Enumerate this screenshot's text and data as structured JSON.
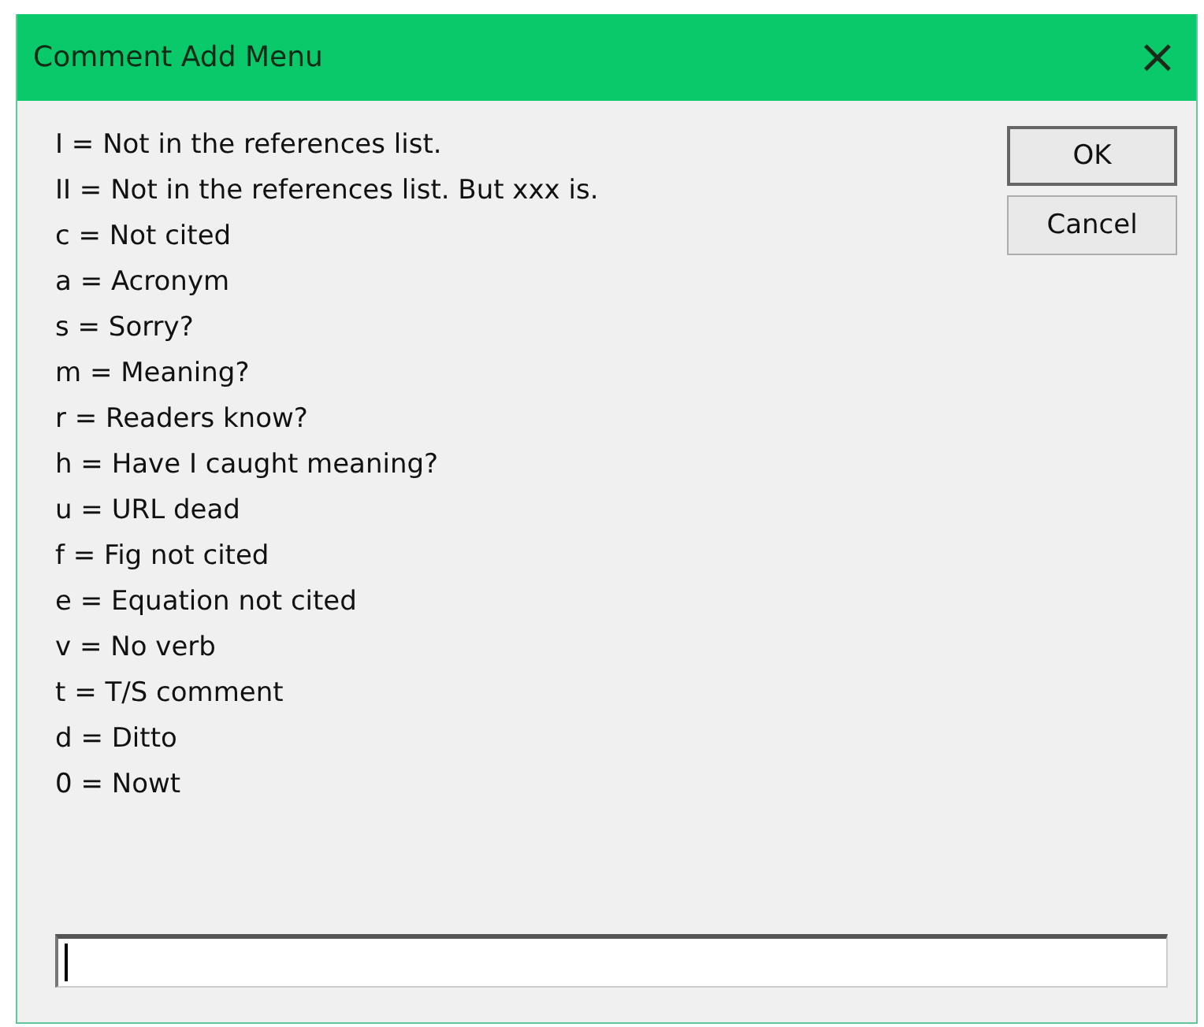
{
  "window": {
    "title": "Comment Add Menu",
    "close": "×"
  },
  "items": [
    "I = Not in the references list.",
    "II = Not in the references list. But xxx is.",
    "c = Not cited",
    "a = Acronym",
    "s = Sorry?",
    "m = Meaning?",
    "r = Readers know?",
    "h = Have I caught meaning?",
    "u = URL dead",
    "f = Fig not cited",
    "e = Equation not cited",
    "v = No verb",
    "t = T/S comment",
    "d = Ditto",
    "0 = Nowt"
  ],
  "buttons": [
    {
      "label": "OK",
      "default": true
    },
    {
      "label": "Cancel",
      "default": false
    }
  ],
  "input": {
    "focused": true
  }
}
